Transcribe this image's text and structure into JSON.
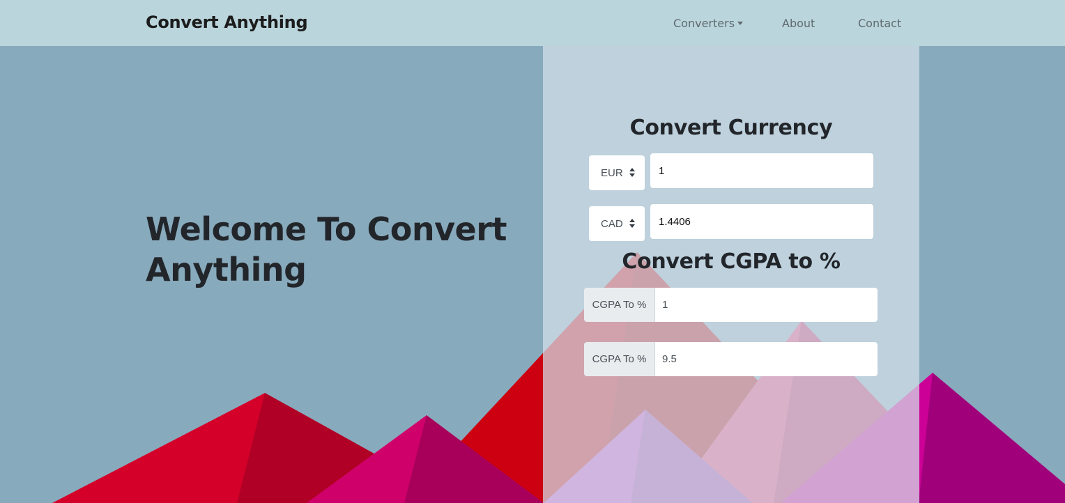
{
  "navbar": {
    "brand": "Convert Anything",
    "links": [
      {
        "label": "Converters",
        "has_dropdown": true
      },
      {
        "label": "About"
      },
      {
        "label": "Contact"
      }
    ]
  },
  "hero": {
    "title": "Welcome To Convert Anything"
  },
  "currency": {
    "title": "Convert Currency",
    "from_currency": "EUR",
    "from_value": "1",
    "to_currency": "CAD",
    "to_value": "1.4406"
  },
  "cgpa": {
    "title": "Convert CGPA to %",
    "rows": [
      {
        "addon": "CGPA To %",
        "value": "1"
      },
      {
        "addon": "CGPA To %",
        "value": "9.5"
      }
    ]
  },
  "colors": {
    "navbar_bg": "#bad5dc",
    "page_bg": "#88aabd",
    "text_dark": "#22262a",
    "mountain_red": "#d4002a",
    "mountain_magenta": "#d0006b",
    "mountain_purple": "#a0007a"
  }
}
